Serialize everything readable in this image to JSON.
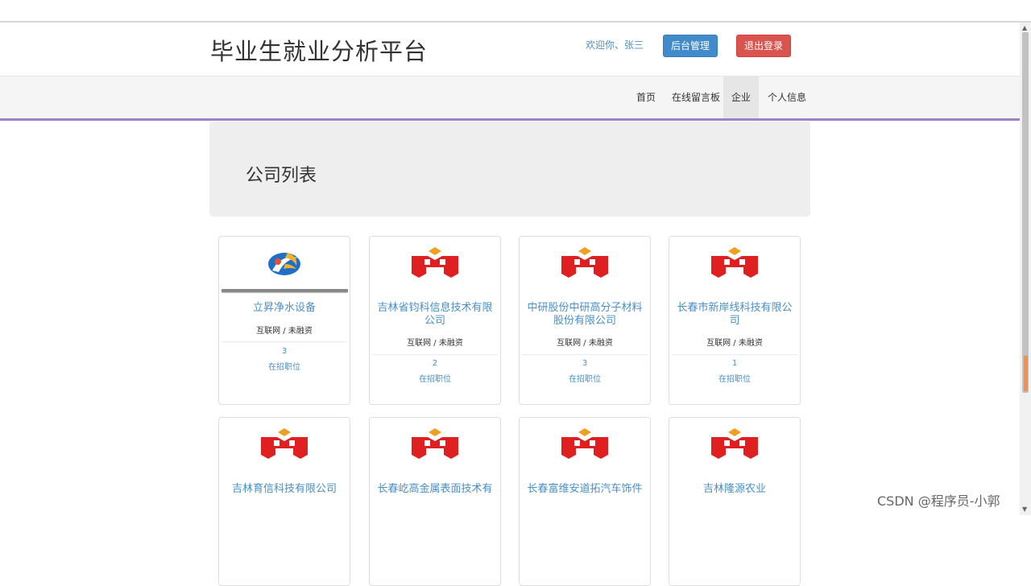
{
  "header": {
    "site_title": "毕业生就业分析平台",
    "welcome": "欢迎你、张三",
    "admin_button": "后台管理",
    "logout_button": "退出登录"
  },
  "nav": {
    "items": [
      {
        "label": "首页"
      },
      {
        "label": "在线留言板"
      },
      {
        "label": "企业",
        "active": true
      },
      {
        "label": "个人信息"
      }
    ]
  },
  "page": {
    "heading": "公司列表"
  },
  "companies": [
    {
      "name": "立昇净水设备",
      "tags": "互联网 / 未融资",
      "jobs": "3",
      "jobs_label": "在招职位",
      "logo": "blue-swirl-logo"
    },
    {
      "name": "吉林省钧科信息技术有限公司",
      "tags": "互联网 / 未融资",
      "jobs": "2",
      "jobs_label": "在招职位",
      "logo": "red-h-logo"
    },
    {
      "name": "中研股份中研高分子材料股份有限公司",
      "tags": "互联网 / 未融资",
      "jobs": "3",
      "jobs_label": "在招职位",
      "logo": "red-h-logo"
    },
    {
      "name": "长春市新岸线科技有限公司",
      "tags": "互联网 / 未融资",
      "jobs": "1",
      "jobs_label": "在招职位",
      "logo": "red-h-logo"
    },
    {
      "name": "吉林育信科技有限公司",
      "logo": "red-h-logo"
    },
    {
      "name": "长春屹高金属表面技术有",
      "logo": "red-h-logo"
    },
    {
      "name": "长春富维安道拓汽车饰件",
      "logo": "red-h-logo"
    },
    {
      "name": "吉林隆源农业",
      "logo": "red-h-logo"
    }
  ],
  "colors": {
    "link": "#4a8fc4",
    "primary_button": "#428bca",
    "danger_button": "#d9534f",
    "nav_accent": "#9b84c6",
    "logo_red": "#e02020",
    "logo_gold": "#f0a020"
  },
  "watermark": "CSDN @程序员-小郭"
}
